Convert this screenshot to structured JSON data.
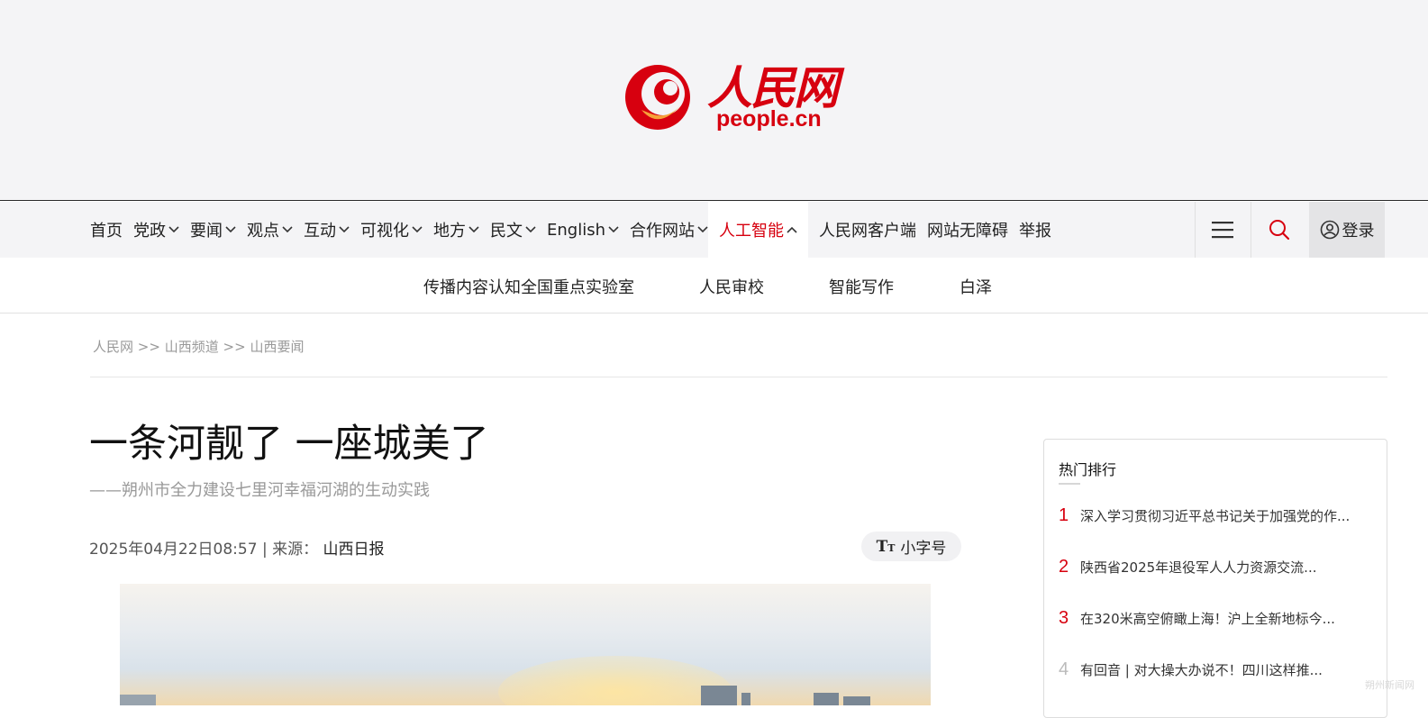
{
  "header": {
    "logo_cn": "人民网",
    "logo_en": "people.cn",
    "colors": {
      "brand": "#d7000f",
      "header_bg": "#f4f4f6"
    }
  },
  "nav": {
    "items": [
      {
        "label": "首页",
        "has_menu": false
      },
      {
        "label": "党政",
        "has_menu": true
      },
      {
        "label": "要闻",
        "has_menu": true
      },
      {
        "label": "观点",
        "has_menu": true
      },
      {
        "label": "互动",
        "has_menu": true
      },
      {
        "label": "可视化",
        "has_menu": true
      },
      {
        "label": "地方",
        "has_menu": true
      },
      {
        "label": "民文",
        "has_menu": true
      },
      {
        "label": "English",
        "has_menu": true
      },
      {
        "label": "合作网站",
        "has_menu": true
      },
      {
        "label": "人工智能",
        "has_menu": true,
        "active": true
      }
    ],
    "links": [
      "人民网客户端",
      "网站无障碍",
      "举报"
    ],
    "menu_icon": "hamburger-icon",
    "search_icon": "search-icon",
    "login_label": "登录",
    "login_icon": "user-circle-icon"
  },
  "subnav": {
    "items": [
      "传播内容认知全国重点实验室",
      "人民审校",
      "智能写作",
      "白泽"
    ]
  },
  "breadcrumb": {
    "home": "人民网",
    "sep": ">>",
    "channel": "山西频道",
    "section": "山西要闻"
  },
  "article": {
    "title": "一条河靓了 一座城美了",
    "subtitle": "——朔州市全力建设七里河幸福河湖的生动实践",
    "date": "2025年04月22日08:57",
    "source_label": "| 来源：",
    "source": "山西日报",
    "font_toggle_label": "小字号"
  },
  "hot": {
    "title": "热门排行",
    "items": [
      {
        "rank": "1",
        "text": "深入学习贯彻习近平总书记关于加强党的作..."
      },
      {
        "rank": "2",
        "text": "陕西省2025年退役军人人力资源交流..."
      },
      {
        "rank": "3",
        "text": "在320米高空俯瞰上海！沪上全新地标今..."
      },
      {
        "rank": "4",
        "text": "有回音 | 对大操大办说不！四川这样推..."
      }
    ]
  },
  "watermark": "朔州新闻网"
}
